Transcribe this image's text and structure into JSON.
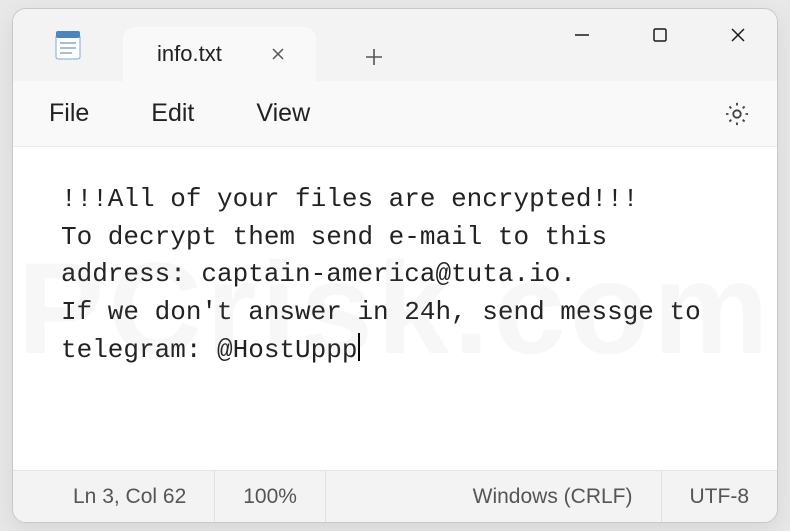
{
  "window": {
    "tab_title": "info.txt"
  },
  "menubar": {
    "file": "File",
    "edit": "Edit",
    "view": "View"
  },
  "editor": {
    "line1": "!!!All of your files are encrypted!!!",
    "line2": "To decrypt them send e-mail to this address: captain-america@tuta.io.",
    "line3": "If we don't answer in 24h, send messge to telegram: @HostUppp"
  },
  "statusbar": {
    "position": "Ln 3, Col 62",
    "zoom": "100%",
    "line_ending": "Windows (CRLF)",
    "encoding": "UTF-8"
  },
  "watermark": {
    "text": "PCrisk.com"
  }
}
